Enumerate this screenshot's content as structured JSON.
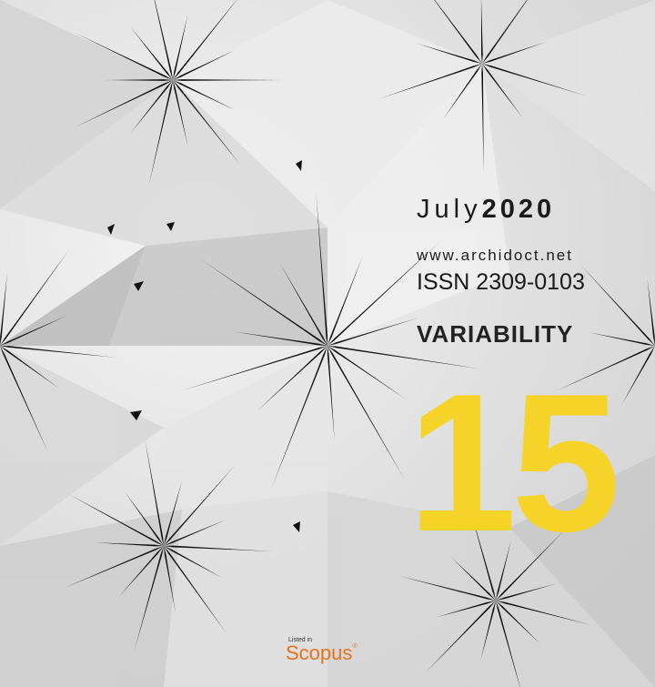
{
  "cover": {
    "month": "July",
    "year": "2020",
    "website": "www.archidoct.net",
    "issn": "ISSN 2309-0103",
    "theme": "VARIABILITY",
    "issue_number": "15"
  },
  "badge": {
    "listed_in": "Listed in",
    "brand": "Scopus",
    "mark": "®"
  },
  "colors": {
    "issue_number": "#f5d328",
    "scopus": "#e9711c",
    "spikes": "#111111"
  },
  "background_image": "folded-paper-pattern"
}
